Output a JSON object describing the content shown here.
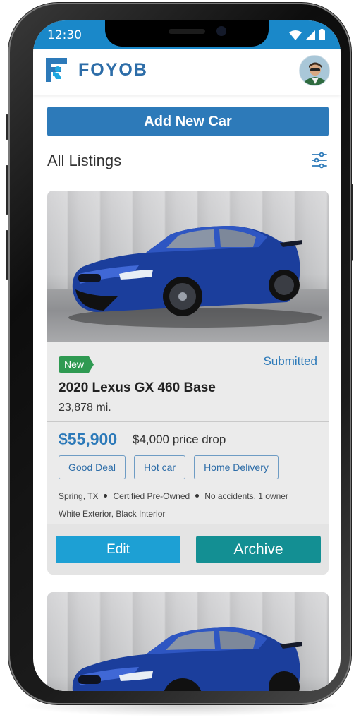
{
  "status_bar": {
    "time": "12:30"
  },
  "header": {
    "brand": "FOYOB"
  },
  "actions": {
    "add_new_car": "Add New Car"
  },
  "listings": {
    "title": "All Listings",
    "items": [
      {
        "badge": "New",
        "status": "Submitted",
        "title": "2020 Lexus GX 460 Base",
        "mileage": "23,878 mi.",
        "price": "$55,900",
        "price_drop": "$4,000 price drop",
        "tags": [
          "Good Deal",
          "Hot car",
          "Home Delivery"
        ],
        "specs": [
          "Spring, TX",
          "Certified Pre-Owned",
          "No accidents, 1 owner"
        ],
        "colors": "White Exterior, Black Interior",
        "edit_label": "Edit",
        "archive_label": "Archive"
      }
    ]
  },
  "theme": {
    "primary": "#2d7ab9",
    "status_bar": "#1a88c9",
    "badge_new": "#2f9a52",
    "edit_button": "#1da0d4",
    "archive_button": "#138f93"
  }
}
